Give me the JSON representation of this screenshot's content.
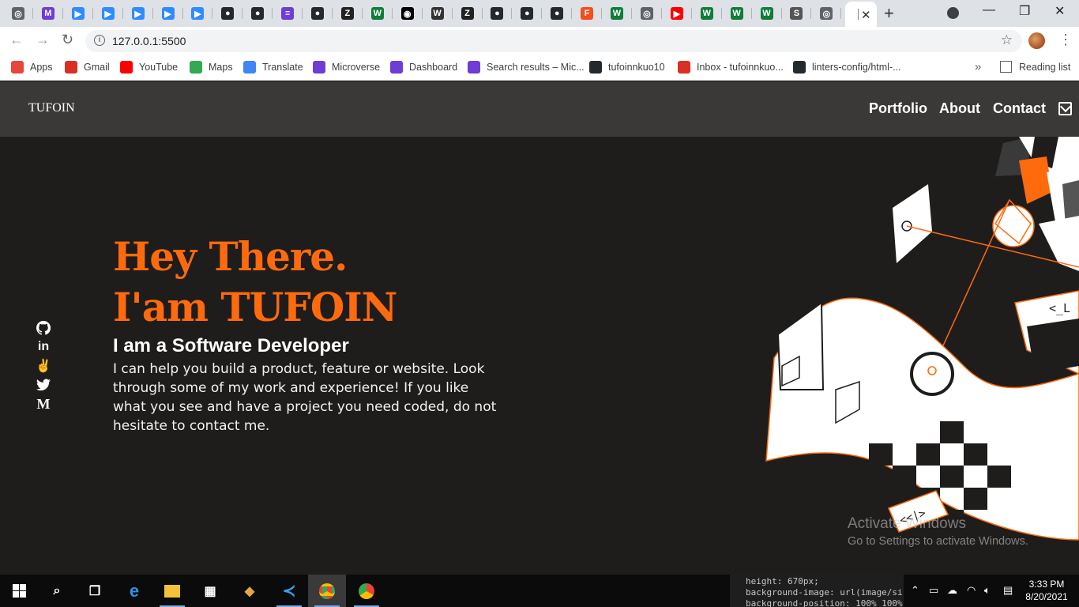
{
  "browser": {
    "url": "127.0.0.1:5500",
    "bookmarks": [
      {
        "label": "Apps",
        "icon": "apps-grid-icon",
        "color": "#e8453c"
      },
      {
        "label": "Gmail",
        "icon": "gmail-icon",
        "color": "#d93025"
      },
      {
        "label": "YouTube",
        "icon": "youtube-icon",
        "color": "#ff0000"
      },
      {
        "label": "Maps",
        "icon": "maps-pin-icon",
        "color": "#34a853"
      },
      {
        "label": "Translate",
        "icon": "translate-icon",
        "color": "#4285f4"
      },
      {
        "label": "Microverse",
        "icon": "microverse-icon",
        "color": "#6f3cd6"
      },
      {
        "label": "Dashboard",
        "icon": "microverse-icon",
        "color": "#6f3cd6"
      },
      {
        "label": "Search results – Mic...",
        "icon": "microverse-icon",
        "color": "#6f3cd6"
      },
      {
        "label": "tufoinnkuo10",
        "icon": "github-icon",
        "color": "#24292e"
      },
      {
        "label": "Inbox - tufoinnkuo...",
        "icon": "gmail-icon",
        "color": "#d93025"
      },
      {
        "label": "linters-config/html-...",
        "icon": "github-icon",
        "color": "#24292e"
      }
    ],
    "more_bookmarks": "»",
    "reading_list": "Reading list",
    "tabs": [
      {
        "glyph": "◎",
        "color": "#5f6368"
      },
      {
        "glyph": "M",
        "color": "#6f3cd6"
      },
      {
        "glyph": "▶",
        "color": "#2d8cff"
      },
      {
        "glyph": "▶",
        "color": "#2d8cff"
      },
      {
        "glyph": "▶",
        "color": "#2d8cff"
      },
      {
        "glyph": "▶",
        "color": "#2d8cff"
      },
      {
        "glyph": "▶",
        "color": "#2d8cff"
      },
      {
        "glyph": "●",
        "color": "#24292e"
      },
      {
        "glyph": "●",
        "color": "#24292e"
      },
      {
        "glyph": "≡",
        "color": "#6f3cd6"
      },
      {
        "glyph": "●",
        "color": "#24292e"
      },
      {
        "glyph": "Z",
        "color": "#222222"
      },
      {
        "glyph": "W",
        "color": "#0f7c3a"
      },
      {
        "glyph": "◉",
        "color": "#000000"
      },
      {
        "glyph": "W",
        "color": "#333333"
      },
      {
        "glyph": "Z",
        "color": "#222222"
      },
      {
        "glyph": "●",
        "color": "#24292e"
      },
      {
        "glyph": "●",
        "color": "#24292e"
      },
      {
        "glyph": "●",
        "color": "#24292e"
      },
      {
        "glyph": "F",
        "color": "#f24e1e"
      },
      {
        "glyph": "W",
        "color": "#0f7c3a"
      },
      {
        "glyph": "◎",
        "color": "#5f6368"
      },
      {
        "glyph": "▶",
        "color": "#ff0000"
      },
      {
        "glyph": "W",
        "color": "#0f7c3a"
      },
      {
        "glyph": "W",
        "color": "#0f7c3a"
      },
      {
        "glyph": "W",
        "color": "#0f7c3a"
      },
      {
        "glyph": "S",
        "color": "#555555"
      },
      {
        "glyph": "◎",
        "color": "#5f6368"
      }
    ]
  },
  "site": {
    "brand": "TUFOIN",
    "menu": [
      "Portfolio",
      "About",
      "Contact"
    ],
    "hero": {
      "line1": "Hey There.",
      "line2": "I'am TUFOIN",
      "role": "I am a Software Developer",
      "description": "I can help you build a product, feature or website. Look through some of my work and experience! If you like what you see and have a project you need coded, do not hesitate to contact me."
    },
    "socials": [
      "github-icon",
      "linkedin-icon",
      "angellist-icon",
      "twitter-icon",
      "medium-icon"
    ],
    "art_code_labels": [
      "<_L",
      "<<|>"
    ],
    "accent_color": "#ff6a0d"
  },
  "windows": {
    "watermark_title": "Activate Windows",
    "watermark_sub": "Go to Settings to activate Windows.",
    "code_peek": [
      "height: 670px;",
      "background-image: url(image/si",
      "background-position: 100% 100%;"
    ],
    "time": "3:33 PM",
    "date": "8/20/2021"
  }
}
